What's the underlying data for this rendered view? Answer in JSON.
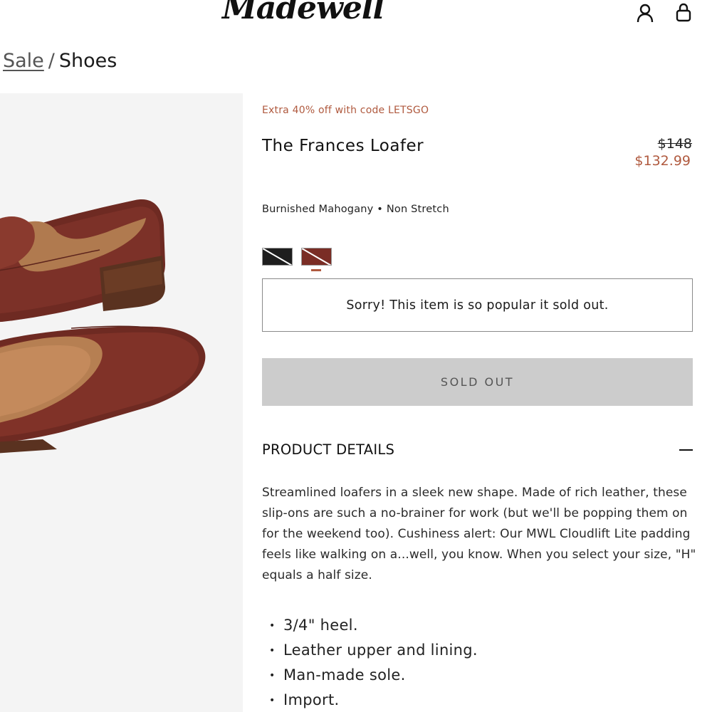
{
  "header": {
    "logo_text": "Madewell",
    "icons": [
      "account-icon",
      "bag-icon"
    ]
  },
  "breadcrumb": {
    "link": "Sale",
    "separator": "/",
    "current": "Shoes"
  },
  "product": {
    "promo": "Extra 40% off with code LETSGO",
    "title": "The Frances Loafer",
    "price_original": "$148",
    "price_sale": "$132.99",
    "color_line": "Burnished Mahogany • Non Stretch",
    "swatches": [
      {
        "name": "black",
        "color": "#1e1e1e"
      },
      {
        "name": "burnished-mahogany",
        "color": "#7a2d25",
        "selected": true
      }
    ],
    "soldout_message": "Sorry! This item is so popular it sold out.",
    "soldout_button": "SOLD OUT"
  },
  "details": {
    "title": "PRODUCT DETAILS",
    "description": "Streamlined loafers in a sleek new shape. Made of rich leather, these slip-ons are such a no-brainer for work (but we'll be popping them on for the weekend too). Cushiness alert: Our MWL Cloudlift Lite padding feels like walking on a...well, you know. When you select your size, \"H\" equals a half size.",
    "bullets": [
      "3/4\" heel.",
      "Leather upper and lining.",
      "Man-made sole.",
      "Import."
    ]
  },
  "colors": {
    "accent": "#b05a3f",
    "button_bg": "#cccccc",
    "image_bg": "#f4f4f4"
  }
}
